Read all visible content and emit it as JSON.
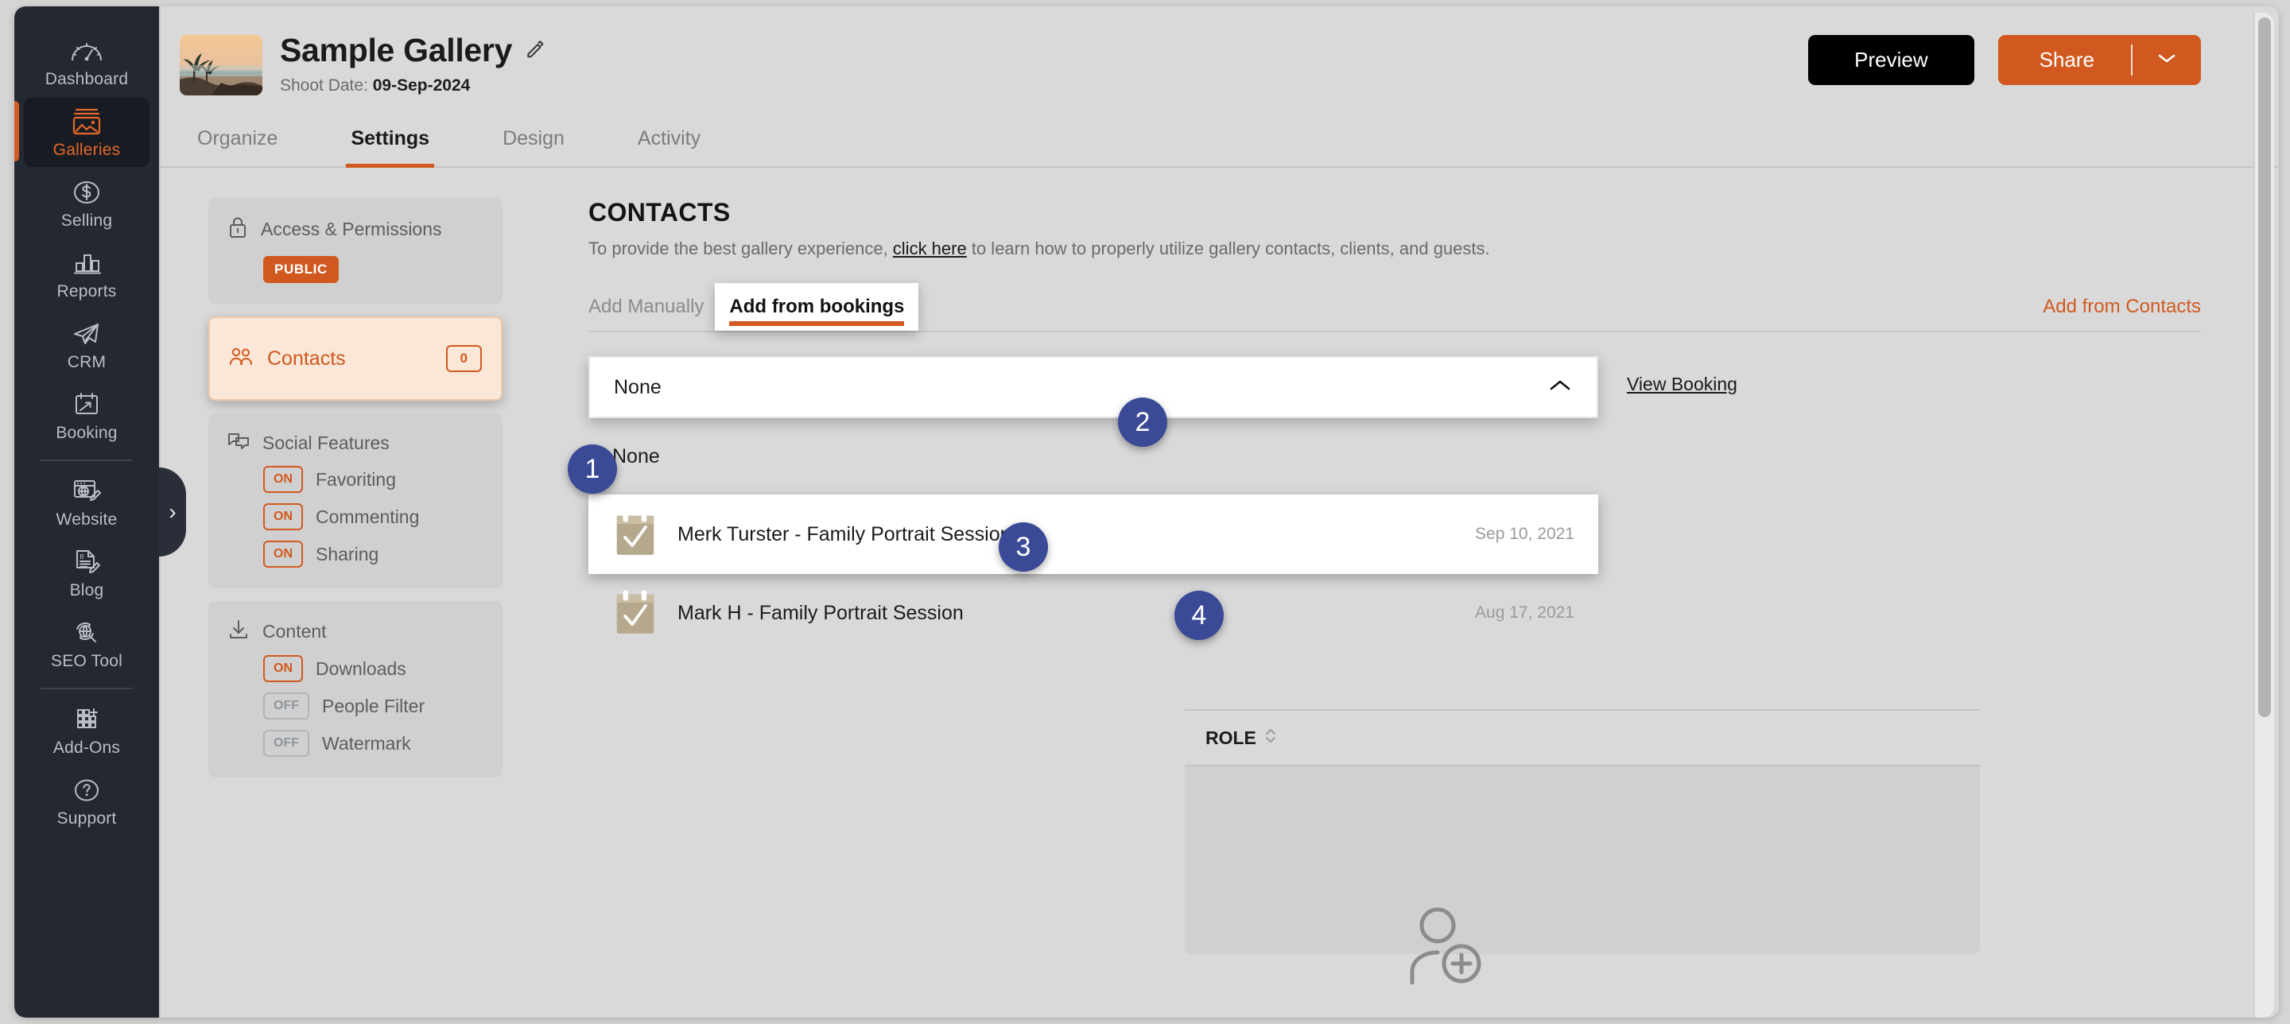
{
  "sidebar": {
    "items": [
      {
        "label": "Dashboard",
        "icon": "speedometer-icon",
        "active": false
      },
      {
        "label": "Galleries",
        "icon": "photos-icon",
        "active": true
      },
      {
        "label": "Selling",
        "icon": "dollar-circle-icon",
        "active": false
      },
      {
        "label": "Reports",
        "icon": "bar-chart-icon",
        "active": false
      },
      {
        "label": "CRM",
        "icon": "paper-plane-icon",
        "active": false
      },
      {
        "label": "Booking",
        "icon": "calendar-arrow-icon",
        "active": false
      },
      {
        "label": "Website",
        "icon": "browser-globe-pencil-icon",
        "active": false
      },
      {
        "label": "Blog",
        "icon": "document-pencil-icon",
        "active": false
      },
      {
        "label": "SEO Tool",
        "icon": "globe-search-icon",
        "active": false
      },
      {
        "label": "Add-Ons",
        "icon": "grid-plus-icon",
        "active": false
      },
      {
        "label": "Support",
        "icon": "question-circle-icon",
        "active": false
      }
    ],
    "collapse_handle": "›"
  },
  "header": {
    "gallery_title": "Sample Gallery",
    "shoot_date_label": "Shoot Date:",
    "shoot_date_value": "09-Sep-2024",
    "preview_label": "Preview",
    "share_label": "Share",
    "share_caret": "⌄"
  },
  "tabs": [
    {
      "label": "Organize",
      "active": false
    },
    {
      "label": "Settings",
      "active": true
    },
    {
      "label": "Design",
      "active": false
    },
    {
      "label": "Activity",
      "active": false
    }
  ],
  "settings_panel": {
    "access": {
      "title": "Access & Permissions",
      "badge": "PUBLIC"
    },
    "contacts": {
      "label": "Contacts",
      "count": "0"
    },
    "social": {
      "title": "Social Features",
      "toggles": [
        {
          "state": "ON",
          "label": "Favoriting"
        },
        {
          "state": "ON",
          "label": "Commenting"
        },
        {
          "state": "ON",
          "label": "Sharing"
        }
      ]
    },
    "content": {
      "title": "Content",
      "toggles": [
        {
          "state": "ON",
          "label": "Downloads"
        },
        {
          "state": "OFF",
          "label": "People Filter"
        },
        {
          "state": "OFF",
          "label": "Watermark"
        }
      ]
    }
  },
  "main": {
    "section_title": "CONTACTS",
    "description_before": "To provide the best gallery experience,",
    "description_link": "click here",
    "description_after": "to learn how to properly utilize gallery contacts, clients, and guests.",
    "subtabs": {
      "add_manually": "Add Manually",
      "add_from_bookings": "Add from bookings",
      "add_from_contacts": "Add from Contacts"
    },
    "booking_select": {
      "value": "None",
      "caret": "⌃",
      "view_booking_label": "View Booking",
      "options": [
        {
          "label": "None",
          "date": "",
          "icon": "",
          "focused": false
        },
        {
          "label": "Merk Turster - Family Portrait Session",
          "date": "Sep 10, 2021",
          "icon": "calendar-check-icon",
          "focused": true
        },
        {
          "label": "Mark H - Family Portrait Session",
          "date": "Aug 17, 2021",
          "icon": "calendar-check-icon",
          "focused": false
        }
      ]
    },
    "table": {
      "columns": [
        {
          "label": "ROLE",
          "sortable": true
        }
      ],
      "rows": [],
      "empty_icon": "add-person-icon"
    }
  },
  "annotations": [
    {
      "id": "1",
      "number": "1"
    },
    {
      "id": "2",
      "number": "2"
    },
    {
      "id": "3",
      "number": "3"
    },
    {
      "id": "4",
      "number": "4"
    }
  ],
  "colors": {
    "accent": "#d1591f",
    "sidebar_bg": "#242830",
    "badge_blue": "#3a4a96",
    "page_bg": "#d9d9d9"
  }
}
